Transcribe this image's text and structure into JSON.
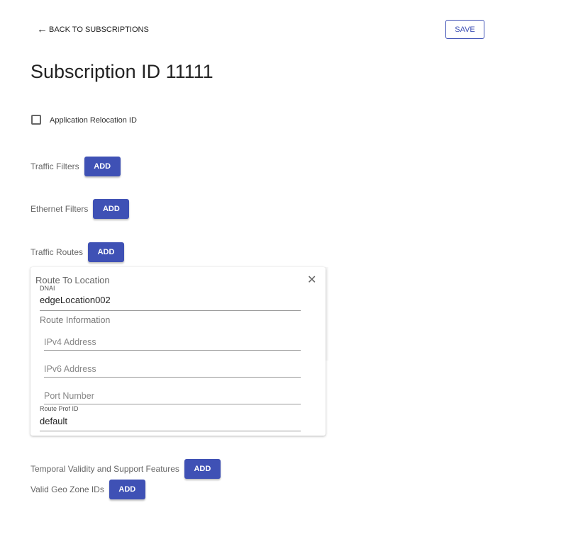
{
  "header": {
    "back_label": "BACK TO SUBSCRIPTIONS",
    "save_label": "SAVE",
    "title": "Subscription ID 11111"
  },
  "app_relocation": {
    "label": "Application Relocation ID",
    "checked": false
  },
  "sections": {
    "traffic_filters": "Traffic Filters",
    "ethernet_filters": "Ethernet Filters",
    "traffic_routes": "Traffic Routes",
    "temporal": "Temporal Validity and Support Features",
    "geo_zone": "Valid Geo Zone IDs",
    "add_label": "ADD"
  },
  "route_card": {
    "title": "Route To Location",
    "dnai_label": "DNAI",
    "dnai_value": "edgeLocation002",
    "route_info_label": "Route Information",
    "ipv4_placeholder": "IPv4 Address",
    "ipv6_placeholder": "IPv6 Address",
    "port_placeholder": "Port Number",
    "route_prof_label": "Route Prof ID",
    "route_prof_value": "default"
  }
}
